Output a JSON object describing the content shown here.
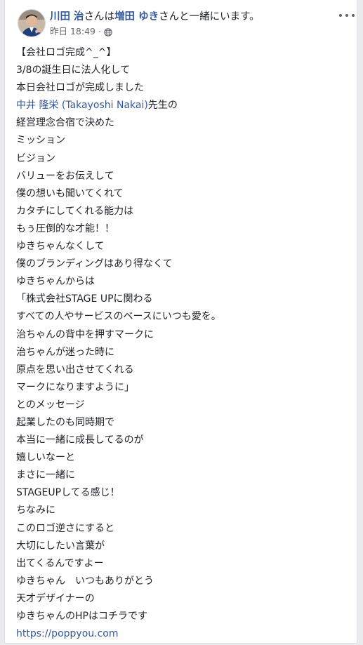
{
  "header": {
    "author": "川田 治",
    "with_text": "さんは",
    "tagged": "増田 ゆき",
    "suffix": "さんと一緒にいます。",
    "timestamp": "昨日 18:49",
    "separator": "·",
    "privacy_icon": "globe-icon",
    "more_icon": "more-horizontal-icon"
  },
  "post": {
    "lines": [
      "【会社ロゴ完成^_^】",
      "3/8の誕生日に法人化して",
      "本日会社ロゴが完成しました",
      "",
      "経営理念合宿で決めた",
      "ミッション",
      "ビジョン",
      "バリューをお伝えして",
      "僕の想いも聞いてくれて",
      "カタチにしてくれる能力は",
      "もぅ圧倒的な才能！！",
      "ゆきちゃんなくして",
      "僕のブランディングはあり得なくて",
      "ゆきちゃんからは",
      "「株式会社STAGE UPに関わる",
      "すべての人やサービスのベースにいつも愛を。",
      "治ちゃんの背中を押すマークに",
      "治ちゃんが迷った時に",
      "原点を思い出させてくれる",
      "マークになりますように」",
      "とのメッセージ",
      "起業したのも同時期で",
      "本当に一緒に成長してるのが",
      "嬉しいなーと",
      "まさに一緒に",
      "STAGEUPしてる感じ！",
      "ちなみに",
      "このロゴ逆さにすると",
      "大切にしたい言葉が",
      "出てくるんですよー",
      "ゆきちゃん　いつもありがとう",
      "天才デザイナーの",
      "ゆきちゃんのHPはコチラです",
      ""
    ],
    "mention_name": "中井 隆栄 (Takayoshi Nakai)",
    "mention_suffix": "先生の",
    "link_text": "https://poppyou.com"
  },
  "colors": {
    "link": "#365899",
    "text": "#1d2129",
    "meta": "#616770",
    "background": "#e9ebee"
  }
}
